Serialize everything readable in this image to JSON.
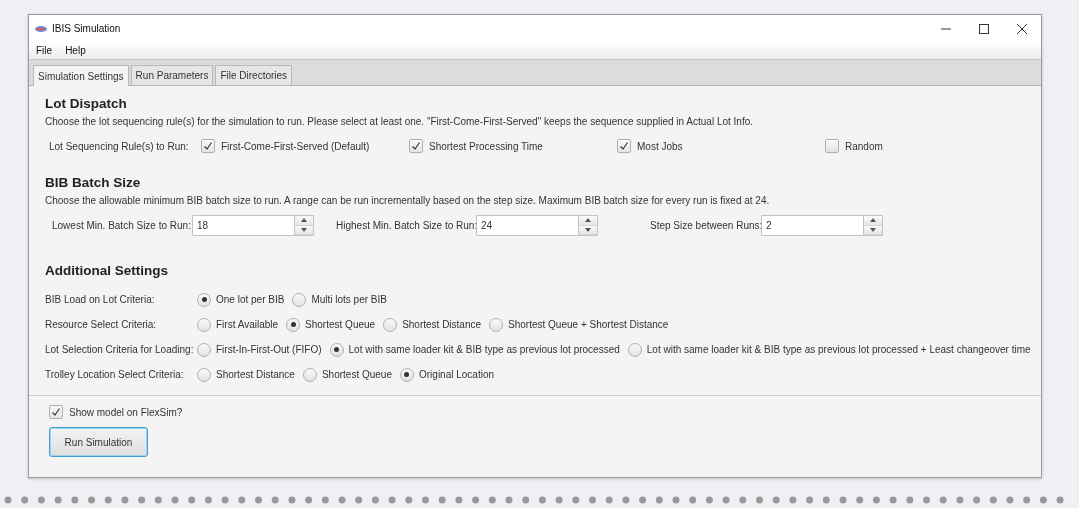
{
  "window": {
    "title": "IBIS Simulation"
  },
  "menu": [
    "File",
    "Help"
  ],
  "tabs": [
    {
      "label": "Simulation Settings",
      "selected": true
    },
    {
      "label": "Run Parameters",
      "selected": false
    },
    {
      "label": "File Directories",
      "selected": false
    }
  ],
  "lot_dispatch": {
    "heading": "Lot Dispatch",
    "description": "Choose the lot sequencing rule(s) for the simulation to run. Please select at least one. \"First-Come-First-Served\" keeps the sequence supplied in Actual Lot Info.",
    "label": "Lot Sequencing Rule(s) to Run:",
    "rules": [
      {
        "label": "First-Come-First-Served (Default)",
        "checked": true
      },
      {
        "label": "Shortest Processing Time",
        "checked": true
      },
      {
        "label": "Most Jobs",
        "checked": true
      },
      {
        "label": "Random",
        "checked": false
      }
    ]
  },
  "bib_batch_size": {
    "heading": "BIB Batch Size",
    "description": "Choose the allowable minimum BIB batch size to run. A range can be run incrementally based on the step size.  Maximum BIB batch size for every run is fixed at 24.",
    "spinners": [
      {
        "label": "Lowest Min. Batch Size to Run:",
        "value": "18"
      },
      {
        "label": "Highest Min. Batch Size to Run:",
        "value": "24"
      },
      {
        "label": "Step Size between Runs:",
        "value": "2"
      }
    ]
  },
  "additional_settings": {
    "heading": "Additional Settings",
    "criteria": [
      {
        "label": "BIB Load on Lot Criteria:",
        "options": [
          {
            "label": "One lot per BIB",
            "selected": true
          },
          {
            "label": "Multi lots per BIB",
            "selected": false
          }
        ]
      },
      {
        "label": "Resource Select Criteria:",
        "options": [
          {
            "label": "First Available",
            "selected": false
          },
          {
            "label": "Shortest Queue",
            "selected": true
          },
          {
            "label": "Shortest Distance",
            "selected": false
          },
          {
            "label": "Shortest Queue + Shortest Distance",
            "selected": false
          }
        ]
      },
      {
        "label": "Lot Selection Criteria for Loading:",
        "options": [
          {
            "label": "First-In-First-Out (FIFO)",
            "selected": false
          },
          {
            "label": "Lot with same loader kit & BIB type as previous lot processed",
            "selected": true
          },
          {
            "label": "Lot with same loader kit & BIB type as previous lot processed + Least changeover time",
            "selected": false
          }
        ]
      },
      {
        "label": "Trolley Location Select Criteria:",
        "options": [
          {
            "label": "Shortest Distance",
            "selected": false
          },
          {
            "label": "Shortest Queue",
            "selected": false
          },
          {
            "label": "Original Location",
            "selected": true
          }
        ]
      }
    ]
  },
  "show_model": {
    "label": "Show model on FlexSim?",
    "checked": true
  },
  "run_button": "Run Simulation"
}
